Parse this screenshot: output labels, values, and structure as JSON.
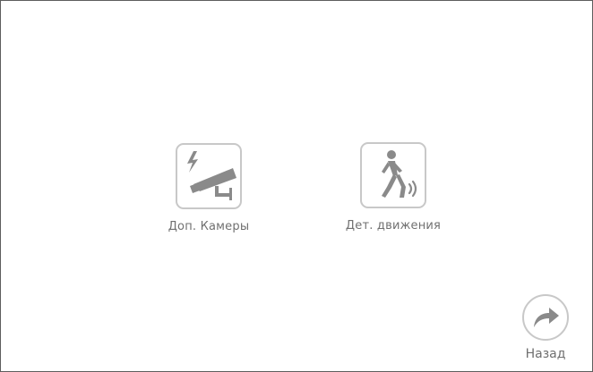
{
  "menu": {
    "items": [
      {
        "label": "Доп. Камеры",
        "icon": "cctv-camera-icon"
      },
      {
        "label": "Дет. движения",
        "icon": "walking-person-motion-icon"
      }
    ]
  },
  "navigation": {
    "back_label": "Назад",
    "back_icon": "forward-arrow-icon"
  },
  "colors": {
    "icon_fill": "#8a8a8a",
    "tile_border": "#c8c8c8",
    "label_text": "#707070"
  }
}
